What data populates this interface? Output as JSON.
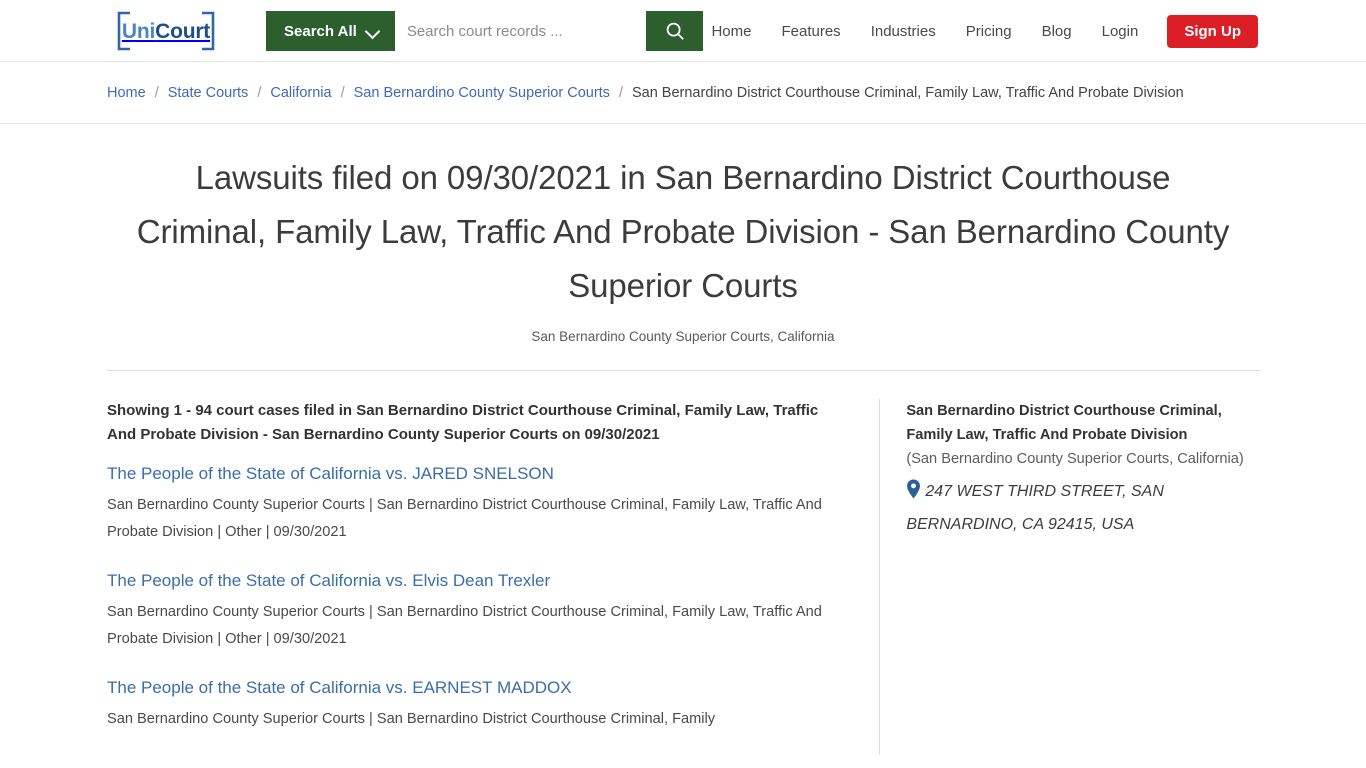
{
  "header": {
    "logo": {
      "part1": "Uni",
      "part2": "Court",
      "icon": "unicourt-logo"
    },
    "search": {
      "scope_label": "Search All",
      "placeholder": "Search court records ...",
      "value": "",
      "submit_icon": "search-icon",
      "dropdown_icon": "chevron-down-icon"
    },
    "nav": [
      {
        "label": "Home"
      },
      {
        "label": "Features"
      },
      {
        "label": "Industries"
      },
      {
        "label": "Pricing"
      },
      {
        "label": "Blog"
      },
      {
        "label": "Login"
      }
    ],
    "signup_label": "Sign Up"
  },
  "breadcrumb": {
    "separator": "/",
    "items": [
      {
        "label": "Home",
        "link": true
      },
      {
        "label": "State Courts",
        "link": true
      },
      {
        "label": "California",
        "link": true
      },
      {
        "label": "San Bernardino County Superior Courts",
        "link": true
      },
      {
        "label": "San Bernardino District Courthouse Criminal, Family Law, Traffic And Probate Division",
        "link": false
      }
    ]
  },
  "page": {
    "title": "Lawsuits filed on 09/30/2021 in San Bernardino District Courthouse Criminal, Family Law, Traffic And Probate Division - San Bernardino County Superior Courts",
    "subtitle": "San Bernardino County Superior Courts, California"
  },
  "results": {
    "showing_text": "Showing 1 - 94 court cases filed in San Bernardino District Courthouse Criminal, Family Law, Traffic And Probate Division - San Bernardino County Superior Courts on 09/30/2021",
    "cases": [
      {
        "title": "The People of the State of California vs. JARED SNELSON",
        "meta": "San Bernardino County Superior Courts | San Bernardino District Courthouse Criminal, Family Law, Traffic And Probate Division | Other | 09/30/2021"
      },
      {
        "title": "The People of the State of California vs. Elvis Dean Trexler",
        "meta": "San Bernardino County Superior Courts | San Bernardino District Courthouse Criminal, Family Law, Traffic And Probate Division | Other | 09/30/2021"
      },
      {
        "title": "The People of the State of California vs. EARNEST MADDOX",
        "meta": "San Bernardino County Superior Courts | San Bernardino District Courthouse Criminal, Family"
      }
    ]
  },
  "sidebar": {
    "court_name": "San Bernardino District Courthouse Criminal, Family Law, Traffic And Probate Division",
    "court_parent": "(San Bernardino County Superior Courts, California)",
    "address": "247 WEST THIRD STREET, SAN BERNARDINO, CA 92415, USA",
    "location_icon": "map-pin-icon"
  },
  "colors": {
    "brand_green": "#2c5e2e",
    "brand_red": "#dc1f26",
    "link_blue": "#3a6ea8",
    "crumb_blue": "#4169b5",
    "pin_blue": "#2a6099"
  }
}
